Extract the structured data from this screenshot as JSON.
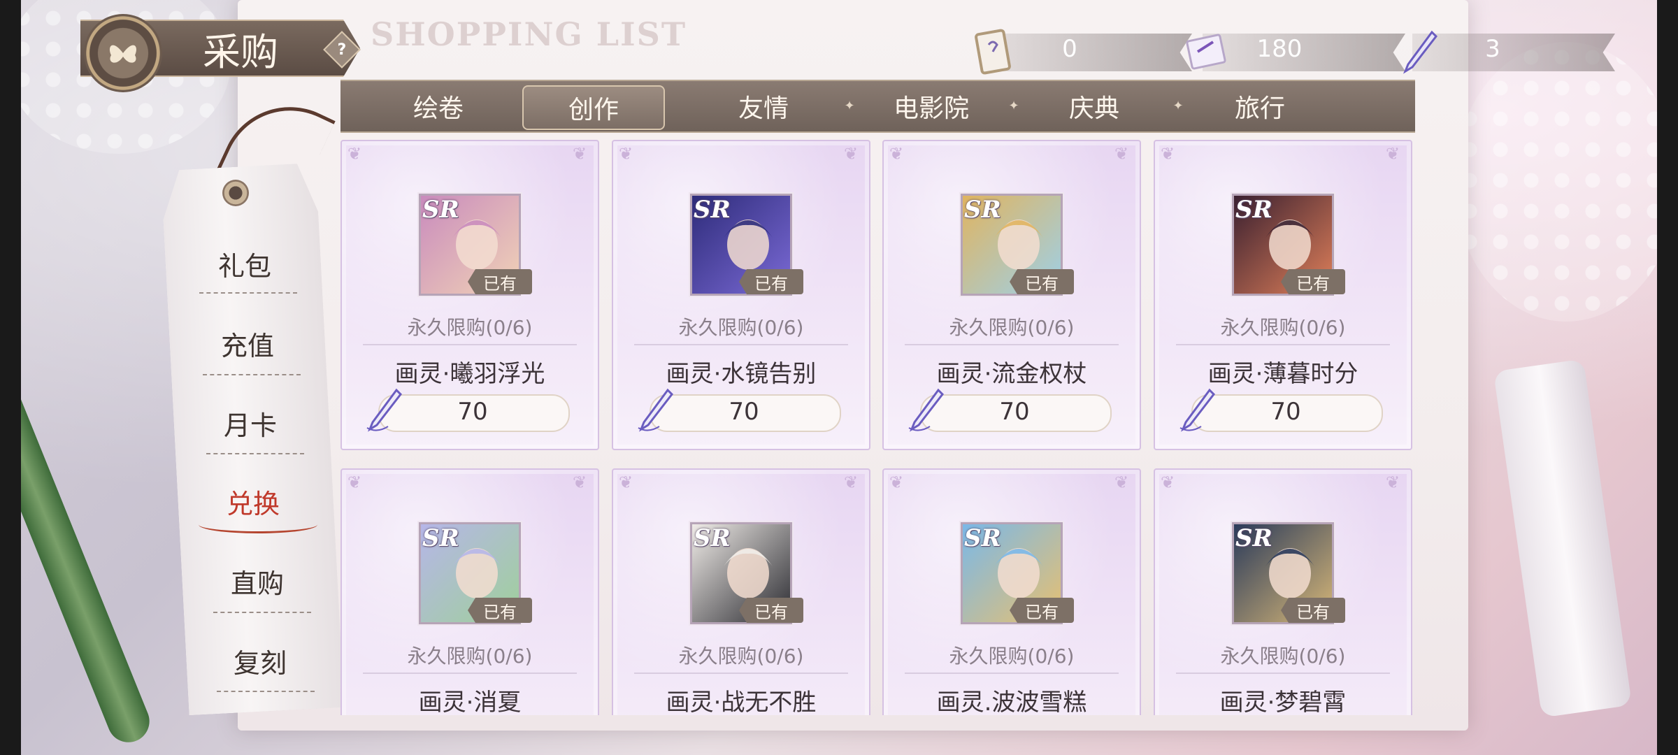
{
  "header": {
    "title": "采购",
    "help": "?",
    "background_title": "SHOPPING LIST"
  },
  "currencies": [
    {
      "icon": "ticket-card-icon",
      "value": "0"
    },
    {
      "icon": "drawing-card-icon",
      "value": "180"
    },
    {
      "icon": "quill-icon",
      "value": "3"
    }
  ],
  "tabs": [
    "绘卷",
    "创作",
    "友情",
    "电影院",
    "庆典",
    "旅行"
  ],
  "active_tab": "创作",
  "sidebar": [
    "礼包",
    "充值",
    "月卡",
    "兑换",
    "直购",
    "复刻"
  ],
  "active_sidebar": "兑换",
  "items": [
    {
      "rarity": "SR",
      "owned": "已有",
      "limit": "永久限购(0/6)",
      "name": "画灵·曦羽浮光",
      "price": "70",
      "colors": [
        "#c98bbd",
        "#f1d3b6"
      ]
    },
    {
      "rarity": "SR",
      "owned": "已有",
      "limit": "永久限购(0/6)",
      "name": "画灵·水镜告别",
      "price": "70",
      "colors": [
        "#2e2c7a",
        "#7b6ad6"
      ]
    },
    {
      "rarity": "SR",
      "owned": "已有",
      "limit": "永久限购(0/6)",
      "name": "画灵·流金权杖",
      "price": "70",
      "colors": [
        "#e0b460",
        "#9ed0e8"
      ]
    },
    {
      "rarity": "SR",
      "owned": "已有",
      "limit": "永久限购(0/6)",
      "name": "画灵·薄暮时分",
      "price": "70",
      "colors": [
        "#3a2030",
        "#e0805a"
      ]
    },
    {
      "rarity": "SR",
      "owned": "已有",
      "limit": "永久限购(0/6)",
      "name": "画灵·消夏",
      "price": "",
      "colors": [
        "#b6b6e8",
        "#9fd09a"
      ]
    },
    {
      "rarity": "SR",
      "owned": "已有",
      "limit": "永久限购(0/6)",
      "name": "画灵·战无不胜",
      "price": "",
      "colors": [
        "#f0ece8",
        "#2a2a30"
      ]
    },
    {
      "rarity": "SR",
      "owned": "已有",
      "limit": "永久限购(0/6)",
      "name": "画灵.波波雪糕",
      "price": "",
      "colors": [
        "#7ab8e8",
        "#e8c070"
      ]
    },
    {
      "rarity": "SR",
      "owned": "已有",
      "limit": "永久限购(0/6)",
      "name": "画灵·梦碧霄",
      "price": "",
      "colors": [
        "#2a3a5a",
        "#d8b878"
      ]
    }
  ]
}
